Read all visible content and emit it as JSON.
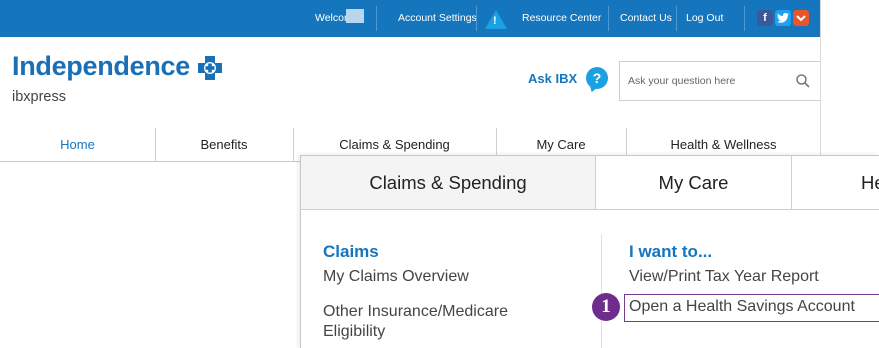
{
  "topbar": {
    "welcome": "Welcome",
    "account_settings": "Account Settings",
    "resource_center": "Resource Center",
    "contact_us": "Contact Us",
    "log_out": "Log Out",
    "warning_glyph": "!",
    "social": {
      "facebook": "f",
      "twitter": "t",
      "more": "⌄"
    }
  },
  "brand": {
    "name": "Independence",
    "subtitle": "ibxpress",
    "accent": "#1676bd"
  },
  "ask": {
    "label": "Ask IBX",
    "bubble": "?",
    "placeholder": "Ask your question here"
  },
  "nav_primary": [
    "Home",
    "Benefits",
    "Claims & Spending",
    "My Care",
    "Health & Wellness"
  ],
  "zoom": {
    "tabs": [
      "Claims & Spending",
      "My Care",
      "He"
    ],
    "claims": {
      "heading": "Claims",
      "items": [
        "My Claims Overview",
        "Other Insurance/Medicare Eligibility"
      ]
    },
    "i_want_to": {
      "heading": "I want to...",
      "items": [
        "View/Print Tax Year Report",
        "Open a Health Savings Account"
      ]
    },
    "callout_number": "1",
    "callout_color": "#6e2c8c"
  },
  "colors": {
    "topbar": "#1676bd",
    "facebook": "#3b5998",
    "twitter": "#1da1f2",
    "more": "#e8552b"
  }
}
